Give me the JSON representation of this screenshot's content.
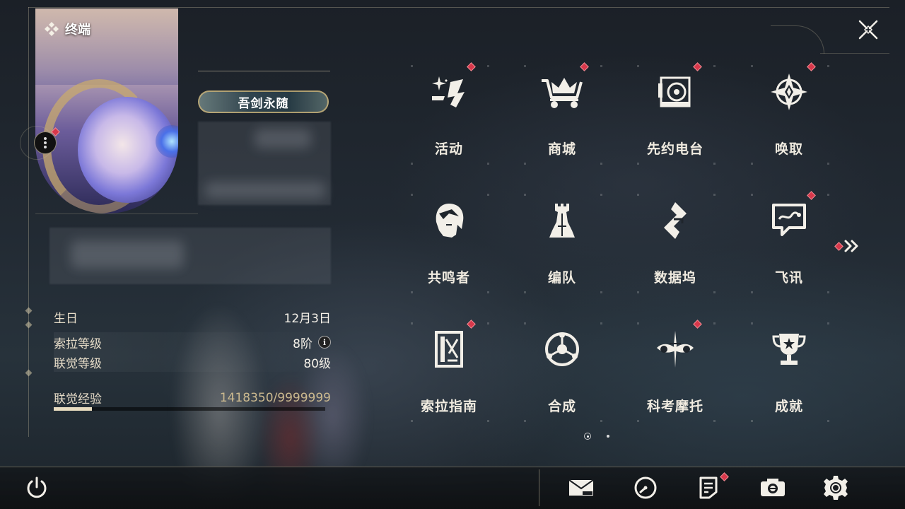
{
  "header": {
    "title": "终端",
    "close_icon": "close-x-icon"
  },
  "profile": {
    "title_badge": "吾剑永随",
    "birthday": {
      "label": "生日",
      "value": "12月3日"
    },
    "sola_level": {
      "label": "索拉等级",
      "value": "8阶"
    },
    "union_level": {
      "label": "联觉等级",
      "value": "80级"
    },
    "union_exp": {
      "label": "联觉经验",
      "value": "1418350/9999999",
      "current": 1418350,
      "max": 9999999
    }
  },
  "menu": {
    "items": [
      {
        "label": "活动",
        "icon": "sparkle-activity-icon",
        "badge": true
      },
      {
        "label": "商城",
        "icon": "crown-cart-icon",
        "badge": true
      },
      {
        "label": "先约电台",
        "icon": "radio-speaker-icon",
        "badge": true
      },
      {
        "label": "唤取",
        "icon": "compass-star-icon",
        "badge": true
      },
      {
        "label": "共鸣者",
        "icon": "character-head-icon",
        "badge": false
      },
      {
        "label": "编队",
        "icon": "chess-team-icon",
        "badge": false
      },
      {
        "label": "数据坞",
        "icon": "data-dock-icon",
        "badge": false
      },
      {
        "label": "飞讯",
        "icon": "chat-message-icon",
        "badge": true
      },
      {
        "label": "索拉指南",
        "icon": "guide-book-icon",
        "badge": true
      },
      {
        "label": "合成",
        "icon": "synthesis-orb-icon",
        "badge": false
      },
      {
        "label": "科考摩托",
        "icon": "motorbike-icon",
        "badge": true
      },
      {
        "label": "成就",
        "icon": "trophy-icon",
        "badge": false
      }
    ],
    "page": {
      "current": 1,
      "total": 2
    }
  },
  "bottom_bar": {
    "items": [
      {
        "name": "power-icon"
      },
      {
        "name": "mail-icon"
      },
      {
        "name": "clock-icon"
      },
      {
        "name": "notice-icon",
        "badge": true
      },
      {
        "name": "camera-icon"
      },
      {
        "name": "settings-gear-icon"
      }
    ]
  },
  "colors": {
    "accent_gold": "#c8b48a",
    "badge_red": "#d8384b",
    "text": "#f0ebe0"
  }
}
